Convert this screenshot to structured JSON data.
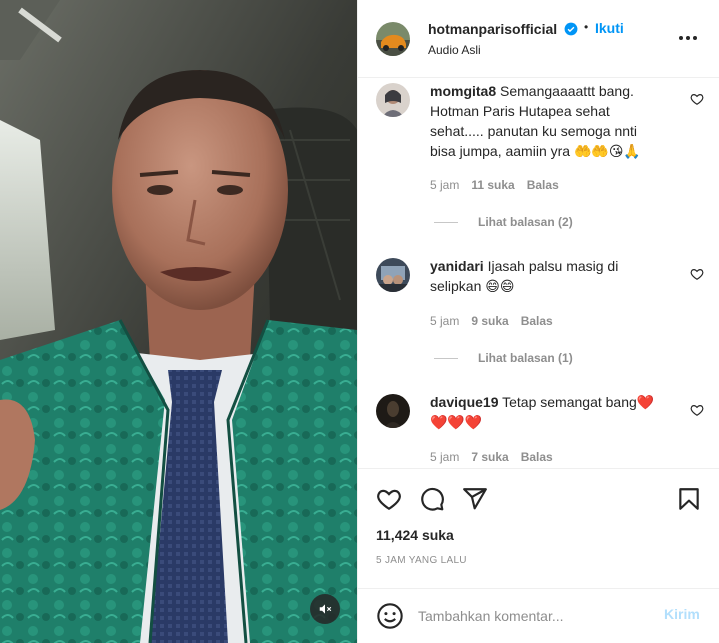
{
  "post": {
    "username": "hotmanparisofficial",
    "separator": "•",
    "follow_label": "Ikuti",
    "audio_label": "Audio Asli",
    "likes_text": "11,424 suka",
    "time_ago": "5 JAM YANG LALU"
  },
  "comments": [
    {
      "username": "momgita8",
      "text": "Semangaaaattt bang. Hotman Paris Hutapea sehat sehat..... panutan ku semoga nnti bisa jumpa, aamiin yra 🤲🤲😘🙏",
      "time": "5 jam",
      "likes": "11 suka",
      "reply_label": "Balas",
      "view_replies": "Lihat balasan (2)"
    },
    {
      "username": "yanidari",
      "text": "Ijasah palsu masig di selipkan 😄😄",
      "time": "5 jam",
      "likes": "9 suka",
      "reply_label": "Balas",
      "view_replies": "Lihat balasan (1)"
    },
    {
      "username": "davique19",
      "text": "Tetap semangat bang❤️❤️❤️❤️",
      "time": "5 jam",
      "likes": "7 suka",
      "reply_label": "Balas"
    }
  ],
  "composer": {
    "placeholder": "Tambahkan komentar...",
    "post_label": "Kirim"
  },
  "colors": {
    "accent": "#0095f6",
    "post_disabled": "#b2dffc",
    "muted": "#8e8e8e",
    "suit": "#1f7f6a"
  },
  "icons": [
    "verified-badge-icon",
    "more-options-icon",
    "heart-icon",
    "comment-icon",
    "share-icon",
    "save-icon",
    "emoji-icon",
    "mute-icon"
  ]
}
